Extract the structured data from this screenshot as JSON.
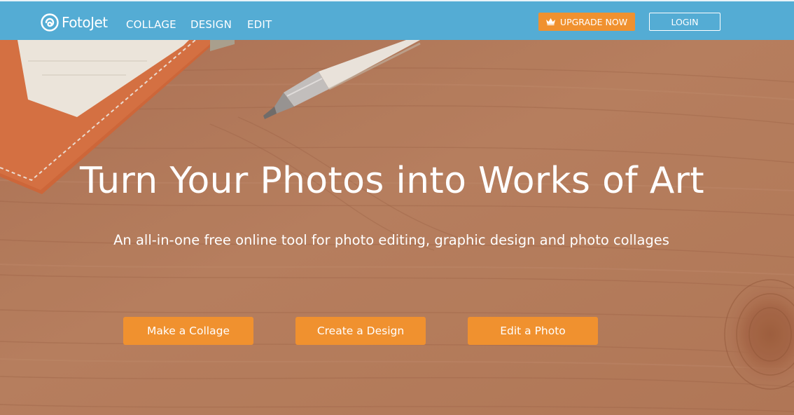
{
  "brand": {
    "name": "FotoJet",
    "logo_icon": "spiral-logo-icon"
  },
  "nav": {
    "items": [
      {
        "label": "COLLAGE"
      },
      {
        "label": "DESIGN"
      },
      {
        "label": "EDIT"
      }
    ],
    "upgrade_label": "UPGRADE NOW",
    "upgrade_icon": "crown-icon",
    "login_label": "LOGIN"
  },
  "hero": {
    "title": "Turn Your Photos into Works of Art",
    "subtitle": "An all-in-one free online tool for photo editing, graphic design and photo collages",
    "buttons": [
      {
        "label": "Make a Collage"
      },
      {
        "label": "Create a Design"
      },
      {
        "label": "Edit a Photo"
      }
    ]
  },
  "colors": {
    "nav_bg": "#54acd4",
    "accent": "#f0912f",
    "wood": "#b57c5c",
    "text": "#ffffff"
  }
}
